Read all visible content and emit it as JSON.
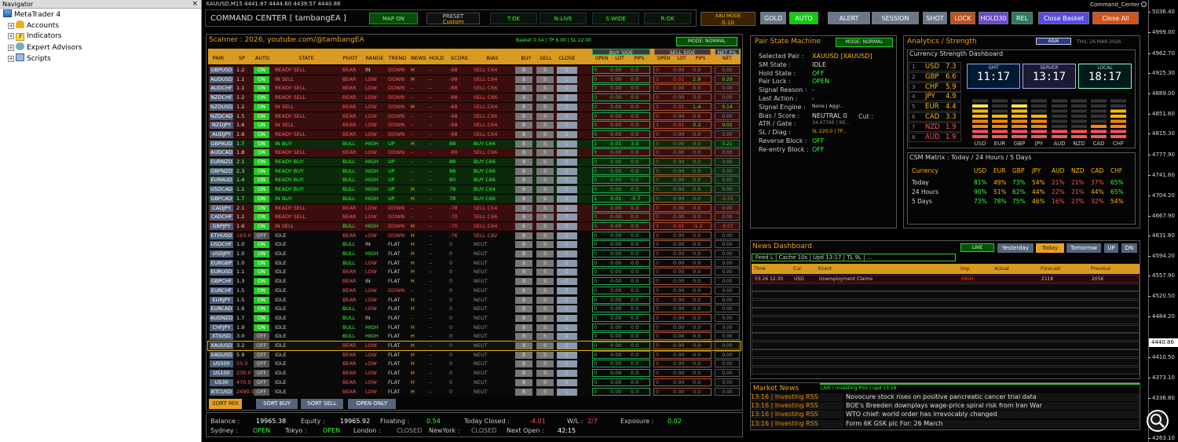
{
  "navigator": {
    "title": "Navigator",
    "close": "×",
    "items": [
      {
        "label": "MetaTrader 4"
      },
      {
        "label": "Accounts"
      },
      {
        "label": "Indicators"
      },
      {
        "label": "Expert Advisors"
      },
      {
        "label": "Scripts"
      }
    ]
  },
  "chart": {
    "symbol_line": "XAUUSD,M15  4441.87 4444.60 4439.57 4440.86",
    "indicator_name": "Command_Center",
    "price_axis": [
      "5036.40",
      "4999.00",
      "4962.70",
      "4925.30",
      "4889.00",
      "4851.60",
      "4815.30",
      "4777.90",
      "4741.60",
      "4704.20",
      "4667.90",
      "4631.60",
      "4594.20",
      "4557.90",
      "4520.50",
      "4484.20",
      "4446.80",
      "4410.50",
      "4373.10",
      "4336.80",
      "4263.10"
    ],
    "current_price": "4440.86"
  },
  "topbar": {
    "title": "COMMAND CENTER [ tambangEA ]",
    "map": "MAP ON",
    "preset_label": "PRESET",
    "preset_value": "Custom",
    "status": [
      "T:OK",
      "N:LIVE",
      "S:WIDE",
      "R:OK"
    ],
    "xau_label": "XAU MODE",
    "xau_value": "0.10",
    "buttons": [
      "GOLD",
      "AUTO",
      "ALERT",
      "SESSION",
      "SHOT",
      "LOCK",
      "HOLD30",
      "REL",
      "Close Basket",
      "Close All"
    ]
  },
  "scanner": {
    "title": "Scanner : 2026, youtube.com/@tambangEA",
    "basket": "Basket 0.54 | TP 6.00 | SL 22.00",
    "mode": "MODE: NORMAL",
    "group_buy": "BUY SIDE",
    "group_sell": "SELL SIDE",
    "group_net": "NET P/L",
    "headers": [
      "PAIR",
      "SP",
      "AUTO",
      "STATE",
      "PIVOT",
      "RANGE",
      "TREND",
      "NEWS",
      "HOLD",
      "SCORE",
      "BIAS",
      "BUY",
      "SELL",
      "CLOSE"
    ],
    "sub_headers": [
      "OPEN",
      "LOT",
      "PIPS",
      "OPEN",
      "LOT",
      "PIPS",
      "NET"
    ],
    "btn_b": "B",
    "btn_s": "S",
    "btn_c": "C",
    "rows": [
      [
        "GBPUSD",
        "1.2",
        "ON",
        "READY SELL",
        "BEAR",
        "IN",
        "DOWN",
        "H",
        "-",
        "-98",
        "SELL C64",
        "0",
        "0.00",
        "0.0",
        "0",
        "0.00",
        "0.0",
        "0.00"
      ],
      [
        "AUDUSD",
        "1.1",
        "ON",
        "IN SELL",
        "BEAR",
        "LOW",
        "DOWN",
        "H",
        "-",
        "-98",
        "SELL C64",
        "0",
        "0.00",
        "0.0",
        "1",
        "0.01",
        "2.9",
        "0.29"
      ],
      [
        "AUDCHF",
        "1.1",
        "ON",
        "READY SELL",
        "BEAR",
        "LOW",
        "DOWN",
        "-",
        "-",
        "-88",
        "SELL C66",
        "0",
        "0.00",
        "0.0",
        "0",
        "0.00",
        "0.0",
        "0.00"
      ],
      [
        "NZDCHF",
        "1.2",
        "ON",
        "READY SELL",
        "BEAR",
        "LOW",
        "DOWN",
        "-",
        "-",
        "-88",
        "SELL C66",
        "0",
        "0.00",
        "0.0",
        "0",
        "0.00",
        "0.0",
        "0.00"
      ],
      [
        "NZDUSD",
        "1.2",
        "ON",
        "IN SELL",
        "BEAR",
        "LOW",
        "DOWN",
        "H",
        "-",
        "-88",
        "SELL C64",
        "0",
        "0.00",
        "0.0",
        "1",
        "0.01",
        "1.4",
        "0.14"
      ],
      [
        "NZDCAD",
        "1.5",
        "ON",
        "READY SELL",
        "BEAR",
        "LOW",
        "DOWN",
        "-",
        "-",
        "-88",
        "SELL C66",
        "0",
        "0.00",
        "0.0",
        "0",
        "0.00",
        "0.0",
        "0.00"
      ],
      [
        "NZDJPY",
        "1.6",
        "ON",
        "IN SELL",
        "BEAR",
        "LOW",
        "DOWN",
        "-",
        "-",
        "-88",
        "SELL C64",
        "0",
        "0.00",
        "0.0",
        "1",
        "0.01",
        "0.2",
        "0.02"
      ],
      [
        "AUDJPY",
        "1.6",
        "ON",
        "READY SELL",
        "BEAR",
        "LOW",
        "DOWN",
        "-",
        "-",
        "-88",
        "SELL C64",
        "0",
        "0.00",
        "0.0",
        "0",
        "0.00",
        "0.0",
        "0.00"
      ],
      [
        "GBPAUD",
        "1.7",
        "ON",
        "IN BUY",
        "BULL",
        "HIGH",
        "UP",
        "H",
        "-",
        "88",
        "BUY C66",
        "1",
        "0.01",
        "3.0",
        "0",
        "0.00",
        "0.0",
        "0.21"
      ],
      [
        "AUDCAD",
        "1.8",
        "ON",
        "READY SELL",
        "BEAR",
        "LOW",
        "DOWN",
        "-",
        "-",
        "-88",
        "SELL C66",
        "0",
        "0.00",
        "0.0",
        "0",
        "0.00",
        "0.0",
        "0.00"
      ],
      [
        "EURNZD",
        "2.1",
        "ON",
        "READY BUY",
        "BULL",
        "HIGH",
        "UP",
        "-",
        "-",
        "88",
        "BUY C66",
        "0",
        "0.00",
        "0.0",
        "0",
        "0.00",
        "0.0",
        "0.00"
      ],
      [
        "GBPNZD",
        "2.3",
        "ON",
        "READY BUY",
        "BULL",
        "HIGH",
        "UP",
        "-",
        "-",
        "88",
        "BUY C66",
        "0",
        "0.00",
        "0.0",
        "0",
        "0.00",
        "0.0",
        "0.00"
      ],
      [
        "EURAUD",
        "1.4",
        "ON",
        "READY BUY",
        "BULL",
        "HIGH",
        "UP",
        "-",
        "-",
        "80",
        "BUY C66",
        "0",
        "0.00",
        "0.0",
        "0",
        "0.00",
        "0.0",
        "0.00"
      ],
      [
        "USDCAD",
        "1.1",
        "ON",
        "READY BUY",
        "BULL",
        "HIGH",
        "UP",
        "H",
        "-",
        "78",
        "BUY C64",
        "0",
        "0.00",
        "0.0",
        "0",
        "0.00",
        "0.0",
        "0.00"
      ],
      [
        "GBPCAD",
        "1.7",
        "ON",
        "IN BUY",
        "BULL",
        "HIGH",
        "UP",
        "H",
        "-",
        "78",
        "BUY C66",
        "1",
        "0.01",
        "-0.7",
        "0",
        "0.00",
        "0.0",
        "-0.05"
      ],
      [
        "CADJPY",
        "2.1",
        "ON",
        "READY SELL",
        "BEAR",
        "LOW",
        "DOWN",
        "-",
        "-",
        "-78",
        "SELL C64",
        "0",
        "0.00",
        "0.0",
        "0",
        "0.00",
        "0.0",
        "0.00"
      ],
      [
        "CADCHF",
        "1.2",
        "ON",
        "READY SELL",
        "BEAR",
        "LOW",
        "DOWN",
        "-",
        "-",
        "-70",
        "SELL C66",
        "0",
        "0.00",
        "0.0",
        "0",
        "0.00",
        "0.0",
        "0.00"
      ],
      [
        "GBPJPY",
        "1.6",
        "ON",
        "IN SELL",
        "BULL",
        "HIGH",
        "DOWN",
        "H",
        "-",
        "-70",
        "SELL C64",
        "0",
        "0.00",
        "0.0",
        "1",
        "0.01",
        "-1.2",
        "-0.07"
      ],
      [
        "ETHUSD",
        "193.0",
        "OFF",
        "IDLE",
        "BEAR",
        "LOW",
        "DOWN",
        "H",
        "-",
        "-76",
        "SELL C82",
        "0",
        "0.00",
        "0.0",
        "0",
        "0.00",
        "0.0",
        "0.00"
      ],
      [
        "USDCHF",
        "1.0",
        "ON",
        "IDLE",
        "BULL",
        "IN",
        "FLAT",
        "H",
        "-",
        "0",
        "NEUT",
        "0",
        "0.00",
        "0.0",
        "0",
        "0.00",
        "0.0",
        "0.00"
      ],
      [
        "USDJPY",
        "1.0",
        "ON",
        "IDLE",
        "BULL",
        "HIGH",
        "FLAT",
        "H",
        "-",
        "0",
        "NEUT",
        "0",
        "0.00",
        "0.0",
        "0",
        "0.00",
        "0.0",
        "0.00"
      ],
      [
        "EURGBP",
        "1.0",
        "ON",
        "IDLE",
        "BULL",
        "LOW",
        "FLAT",
        "H",
        "-",
        "0",
        "NEUT",
        "0",
        "0.00",
        "0.0",
        "0",
        "0.00",
        "0.0",
        "0.00"
      ],
      [
        "EURUSD",
        "1.1",
        "ON",
        "IDLE",
        "BEAR",
        "LOW",
        "FLAT",
        "H",
        "-",
        "0",
        "NEUT",
        "0",
        "0.00",
        "0.0",
        "0",
        "0.00",
        "0.0",
        "0.00"
      ],
      [
        "GBPCHF",
        "1.3",
        "ON",
        "IDLE",
        "BEAR",
        "IN",
        "FLAT",
        "H",
        "-",
        "0",
        "NEUT",
        "0",
        "0.00",
        "0.0",
        "0",
        "0.00",
        "0.0",
        "0.00"
      ],
      [
        "EURCHF",
        "1.5",
        "ON",
        "IDLE",
        "BEAR",
        "LOW",
        "DOWN",
        "-",
        "-",
        "0",
        "NEUT",
        "0",
        "0.00",
        "0.0",
        "0",
        "0.00",
        "0.0",
        "0.00"
      ],
      [
        "EURJPY",
        "1.5",
        "ON",
        "IDLE",
        "BEAR",
        "LOW",
        "FLAT",
        "H",
        "-",
        "0",
        "NEUT",
        "0",
        "0.00",
        "0.0",
        "0",
        "0.00",
        "0.0",
        "0.00"
      ],
      [
        "EURCAD",
        "1.6",
        "ON",
        "IDLE",
        "BULL",
        "LOW",
        "FLAT",
        "H",
        "-",
        "0",
        "NEUT",
        "0",
        "0.00",
        "0.0",
        "0",
        "0.00",
        "0.0",
        "0.00"
      ],
      [
        "AUDNZD",
        "1.7",
        "ON",
        "IDLE",
        "BULL",
        "IN",
        "FLAT",
        "-",
        "-",
        "0",
        "NEUT",
        "0",
        "0.00",
        "0.0",
        "0",
        "0.00",
        "0.0",
        "0.00"
      ],
      [
        "CHFJPY",
        "1.9",
        "ON",
        "IDLE",
        "BULL",
        "HIGH",
        "FLAT",
        "H",
        "-",
        "0",
        "NEUT",
        "0",
        "0.00",
        "0.0",
        "0",
        "0.00",
        "0.0",
        "0.00"
      ],
      [
        "XTIUSD",
        "3.0",
        "OFF",
        "IDLE",
        "BULL",
        "HIGH",
        "FLAT",
        "H",
        "-",
        "0",
        "NEUT",
        "0",
        "0.00",
        "0.0",
        "0",
        "0.00",
        "0.0",
        "0.00"
      ],
      [
        "XAUUSD",
        "3.2",
        "OFF",
        "IDLE",
        "BEAR",
        "LOW",
        "FLAT",
        "H",
        "-",
        "0",
        "NEUT",
        "0",
        "0.00",
        "0.0",
        "0",
        "0.00",
        "0.0",
        "0.00"
      ],
      [
        "XAGUSD",
        "5.9",
        "OFF",
        "IDLE",
        "BEAR",
        "LOW",
        "FLAT",
        "H",
        "-",
        "0",
        "NEUT",
        "0",
        "0.00",
        "0.0",
        "0",
        "0.00",
        "0.0",
        "0.00"
      ],
      [
        "US500",
        "55.0",
        "OFF",
        "IDLE",
        "BEAR",
        "LOW",
        "FLAT",
        "H",
        "-",
        "0",
        "NEUT",
        "0",
        "0.00",
        "0.0",
        "0",
        "0.00",
        "0.0",
        "0.00"
      ],
      [
        "US100",
        "230.0",
        "OFF",
        "IDLE",
        "BEAR",
        "LOW",
        "FLAT",
        "H",
        "-",
        "0",
        "NEUT",
        "0",
        "0.00",
        "0.0",
        "0",
        "0.00",
        "0.0",
        "0.00"
      ],
      [
        "US30",
        "470.0",
        "OFF",
        "IDLE",
        "BEAR",
        "LOW",
        "FLAT",
        "H",
        "-",
        "0",
        "NEUT",
        "0",
        "0.00",
        "0.0",
        "0",
        "0.00",
        "0.0",
        "0.00"
      ],
      [
        "BTCUSD",
        "2490.0",
        "OFF",
        "IDLE",
        "BEAR",
        "LOW",
        "FLAT",
        "H",
        "-",
        "0",
        "NEUT",
        "0",
        "0.00",
        "0.0",
        "0",
        "0.00",
        "0.0",
        "0.00"
      ]
    ],
    "sort_buttons": [
      "SORT MIX",
      "SORT BUY",
      "SORT SELL",
      "OPEN ONLY"
    ]
  },
  "account": {
    "balance_l": "Balance :",
    "balance": "19965.38",
    "equity_l": "Equity :",
    "equity": "19965.92",
    "floating_l": "Floating :",
    "floating": "0.54",
    "today_l": "Today Closed :",
    "today": "-4.01",
    "wl_l": "W/L :",
    "wl": "2/7",
    "exposure_l": "Exposure :",
    "exposure": "0.02",
    "sydney_l": "Sydney :",
    "sydney": "OPEN",
    "tokyo_l": "Tokyo :",
    "tokyo": "OPEN",
    "london_l": "London :",
    "london": "CLOSED",
    "newyork_l": "NewYork :",
    "newyork": "CLOSED",
    "next_l": "Next Open :",
    "next": "42:15"
  },
  "psm": {
    "title": "Pair State Machine",
    "mode": "MODE: NORMAL",
    "rows": [
      [
        "Selected Pair :",
        "XAUUSD [XAUUSD]"
      ],
      [
        "SM State :",
        "IDLE"
      ],
      [
        "Hold State :",
        "OFF"
      ],
      [
        "Pair Lock :",
        "OPEN"
      ],
      [
        "Signal Reason :",
        "-"
      ],
      [
        "Last Action :",
        "-"
      ],
      [
        "Signal Engine :",
        "None | Aggr..."
      ],
      [
        "Bias / Score :",
        "NEUTRAL 0"
      ],
      [
        "ATR / Gate :",
        "34.47766 | NE..."
      ],
      [
        "SL / Diag :",
        "SL 220.0 | TP..."
      ],
      [
        "Reverse Block :",
        "OFF"
      ],
      [
        "Re-entry Block :",
        "OFF"
      ]
    ],
    "cut": "Cut :"
  },
  "analytics": {
    "title": "Analytics / Strength",
    "session": "ASIA",
    "date": "THU, 26 MAR 2026",
    "csd_title": "Currency Strength Dashboard",
    "ranks": [
      [
        "1",
        "USD",
        "7.3"
      ],
      [
        "2",
        "GBP",
        "6.6"
      ],
      [
        "3",
        "CHF",
        "5.9"
      ],
      [
        "4",
        "JPY",
        "4.9"
      ],
      [
        "5",
        "EUR",
        "4.4"
      ],
      [
        "6",
        "CAD",
        "3.3"
      ],
      [
        "7",
        "NZD",
        "1.9"
      ],
      [
        "8",
        "AUD",
        "1.9"
      ]
    ],
    "clocks": [
      [
        "GMT",
        "11:17"
      ],
      [
        "SERVER",
        "13:17"
      ],
      [
        "LOCAL",
        "18:17"
      ]
    ],
    "bar_labels": [
      "USD",
      "EUR",
      "GBP",
      "JPY",
      "AUD",
      "NZD",
      "CAD",
      "CHF"
    ],
    "bar_levels": [
      7,
      5,
      7,
      5,
      2,
      2,
      3,
      6
    ],
    "csm_title": "CSM Matrix : Today / 24 Hours / 5 Days",
    "csm_header": [
      "Currency",
      "USD",
      "EUR",
      "GBP",
      "JPY",
      "AUD",
      "NZD",
      "CAD",
      "CHF"
    ],
    "csm_rows": [
      [
        "Today",
        "81%",
        "49%",
        "73%",
        "54%",
        "21%",
        "21%",
        "37%",
        "65%"
      ],
      [
        "24 Hours",
        "90%",
        "51%",
        "62%",
        "44%",
        "22%",
        "21%",
        "44%",
        "65%"
      ],
      [
        "5 Days",
        "73%",
        "78%",
        "75%",
        "46%",
        "16%",
        "27%",
        "32%",
        "54%"
      ]
    ]
  },
  "news": {
    "title": "News Dashboard",
    "live": "LIVE",
    "buttons": [
      "Yesterday",
      "Today",
      "Tomorrow",
      "UP",
      "DN"
    ],
    "feed": "Feed L | Cache 10s | Upd 13:17 | TL 9L | ...",
    "headers": [
      "Time",
      "Cur.",
      "Event",
      "Imp.",
      "Actual",
      "Forecast",
      "Previous"
    ],
    "event": [
      "03.26 12:30",
      "USD",
      "Unemployment Claims",
      "HIGH",
      "",
      "211K",
      "205K"
    ]
  },
  "market_news": {
    "title": "Market News",
    "status": "LIVE | Investing RSS | upd 13:16",
    "items": [
      [
        "13:16 | Investing RSS",
        "Novocure stock rises on positive pancreatic cancer trial data"
      ],
      [
        "13:16 | Investing RSS",
        "BOE's Breeden downplays wage-price spiral risk from Iran War"
      ],
      [
        "13:16 | Investing RSS",
        "WTO chief: world order has irrevocably changed"
      ],
      [
        "13:16 | Investing RSS",
        "Form 6K GSK plc For: 26 March"
      ]
    ]
  }
}
